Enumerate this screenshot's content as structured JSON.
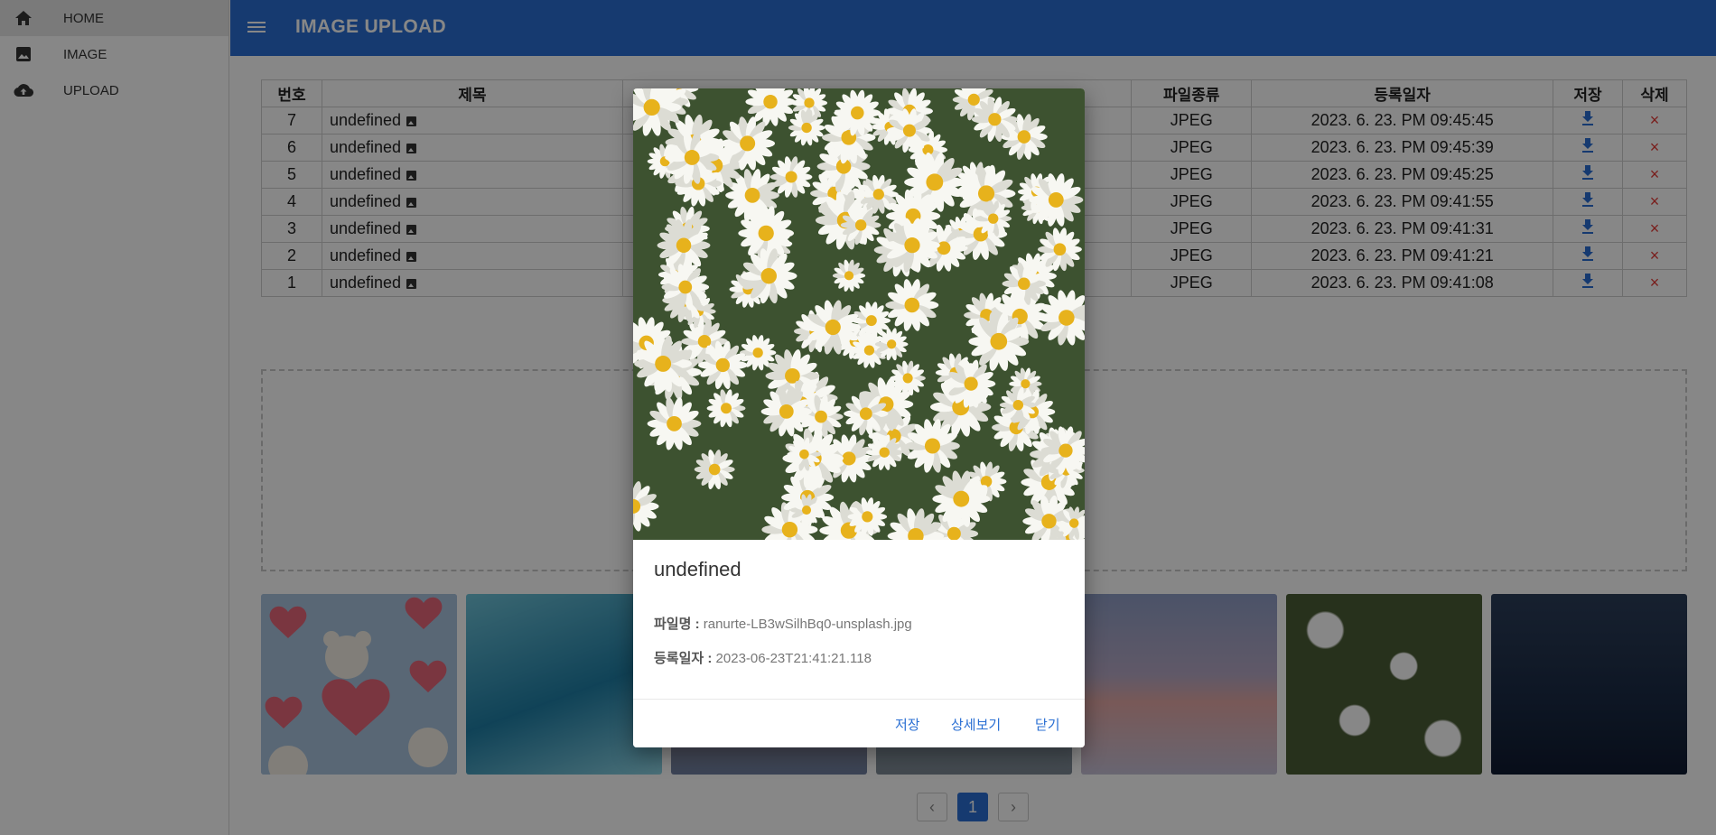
{
  "app": {
    "title": "IMAGE UPLOAD"
  },
  "sidebar": {
    "items": [
      {
        "label": "HOME",
        "icon": "home-icon"
      },
      {
        "label": "IMAGE",
        "icon": "image-icon"
      },
      {
        "label": "UPLOAD",
        "icon": "cloud-upload-icon"
      }
    ]
  },
  "table": {
    "headers": [
      "번호",
      "제목",
      "파일종류",
      "등록일자",
      "저장",
      "삭제"
    ],
    "rows": [
      {
        "no": "7",
        "title": "undefined",
        "type": "JPEG",
        "date": "2023. 6. 23. PM 09:45:45"
      },
      {
        "no": "6",
        "title": "undefined",
        "type": "JPEG",
        "date": "2023. 6. 23. PM 09:45:39"
      },
      {
        "no": "5",
        "title": "undefined",
        "type": "JPEG",
        "date": "2023. 6. 23. PM 09:45:25"
      },
      {
        "no": "4",
        "title": "undefined",
        "type": "JPEG",
        "date": "2023. 6. 23. PM 09:41:55"
      },
      {
        "no": "3",
        "title": "undefined",
        "type": "JPEG",
        "date": "2023. 6. 23. PM 09:41:31"
      },
      {
        "no": "2",
        "title": "undefined",
        "type": "JPEG",
        "date": "2023. 6. 23. PM 09:41:21"
      },
      {
        "no": "1",
        "title": "undefined",
        "type": "JPEG",
        "date": "2023. 6. 23. PM 09:41:08"
      }
    ]
  },
  "gallery": {
    "count": 7
  },
  "pager": {
    "current": "1",
    "prev": "‹",
    "next": "›"
  },
  "modal": {
    "title": "undefined",
    "filename_label": "파일명 :",
    "filename": "ranurte-LB3wSilhBq0-unsplash.jpg",
    "date_label": "등록일자 :",
    "date": "2023-06-23T21:41:21.118",
    "actions": {
      "save": "저장",
      "detail": "상세보기",
      "close": "닫기"
    }
  },
  "colors": {
    "brand": "#2a6fd3",
    "delete": "#e53935"
  }
}
